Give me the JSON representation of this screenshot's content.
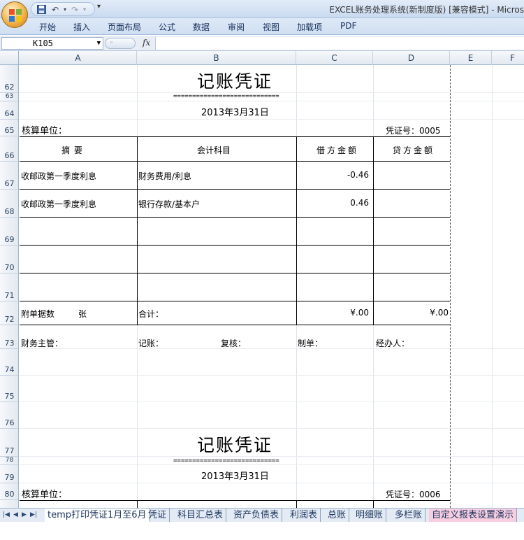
{
  "window": {
    "title": "EXCEL账务处理系统(新制度版)  [兼容模式] - Micros"
  },
  "ribbon": {
    "tabs": [
      "开始",
      "插入",
      "页面布局",
      "公式",
      "数据",
      "审阅",
      "视图",
      "加载项",
      "PDF"
    ]
  },
  "formula_bar": {
    "cell_ref": "K105",
    "fx": "fx"
  },
  "columns": [
    "A",
    "B",
    "C",
    "D",
    "E",
    "F"
  ],
  "rows": [
    "62",
    "63",
    "64",
    "65",
    "66",
    "67",
    "68",
    "69",
    "70",
    "71",
    "72",
    "73",
    "74",
    "75",
    "76",
    "77",
    "78",
    "79",
    "80"
  ],
  "voucher1": {
    "title": "记账凭证",
    "equals": "============================",
    "date": "2013年3月31日",
    "unit_label": "核算单位：",
    "voucher_no": "凭证号：0005",
    "headers": {
      "summary": "摘          要",
      "account": "会计科目",
      "debit": "借方金额",
      "credit": "贷方金额"
    },
    "entries": [
      {
        "summary": "收邮政第一季度利息",
        "account": "财务费用/利息",
        "debit": "-0.46",
        "credit": ""
      },
      {
        "summary": "收邮政第一季度利息",
        "account": "银行存款/基本户",
        "debit": "0.46",
        "credit": ""
      }
    ],
    "attach": "附单据数",
    "attach_unit": "张",
    "total_label": "合计：",
    "total_debit": "¥.00",
    "total_credit": "¥.00",
    "signatures": {
      "supervisor": "财务主管：",
      "bookkeeper": "记账：",
      "reviewer": "复核：",
      "preparer": "制单：",
      "handler": "经办人："
    }
  },
  "voucher2": {
    "title": "记账凭证",
    "equals": "============================",
    "date": "2013年3月31日",
    "unit_label": "核算单位：",
    "voucher_no": "凭证号：0006"
  },
  "sheet_tabs": [
    "temp打印凭证1月至6月",
    "凭证",
    "科目汇总表",
    "资产负债表",
    "利润表",
    "总账",
    "明细账",
    "多栏账",
    "自定义报表设置演示"
  ],
  "colors": {
    "ribbon_bg": "#cfdff2",
    "header_bg": "#e3e9f1",
    "active_tab_pink": "#f7cde0"
  }
}
